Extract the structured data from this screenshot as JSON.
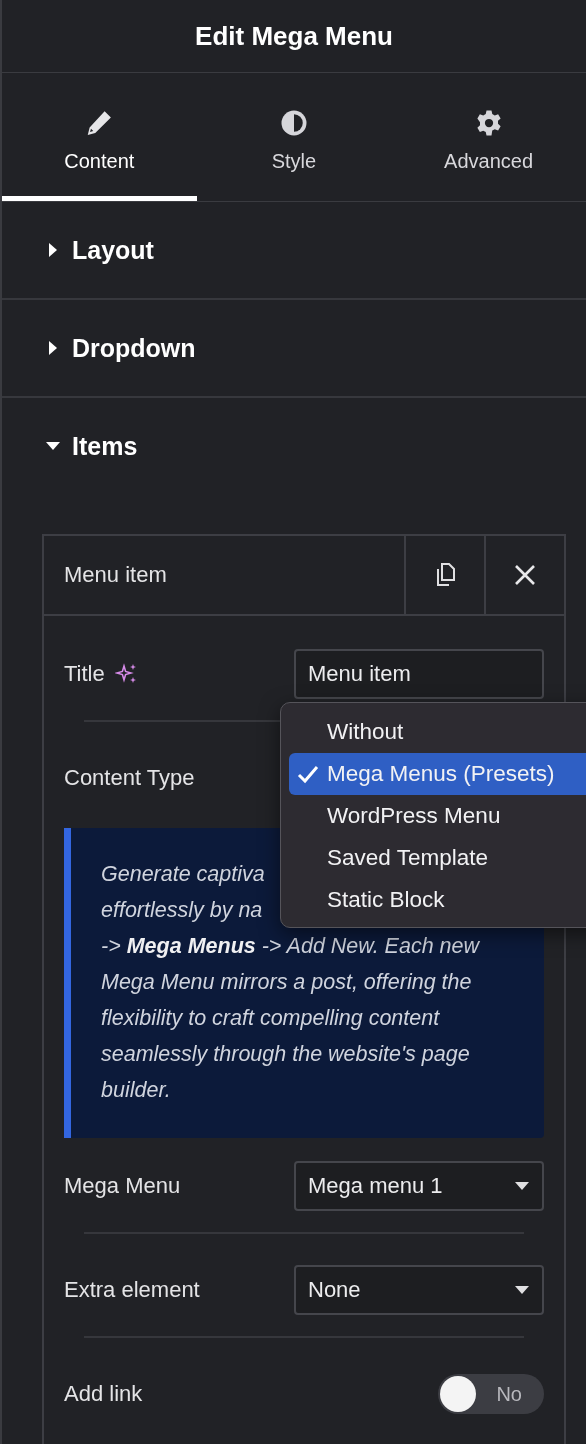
{
  "panel": {
    "title": "Edit Mega Menu"
  },
  "tabs": [
    {
      "label": "Content",
      "selected": true
    },
    {
      "label": "Style",
      "selected": false
    },
    {
      "label": "Advanced",
      "selected": false
    }
  ],
  "sections": [
    {
      "title": "Layout",
      "expanded": false
    },
    {
      "title": "Dropdown",
      "expanded": false
    },
    {
      "title": "Items",
      "expanded": true
    }
  ],
  "item": {
    "title": "Menu item",
    "fields": [
      {
        "kind": "text",
        "label": "Title",
        "value": "Menu item"
      },
      {
        "kind": "open_select",
        "label": "Content Type",
        "options": [
          {
            "label": "Without",
            "selected": false
          },
          {
            "label": "Mega Menus (Presets)",
            "selected": true
          },
          {
            "label": "WordPress Menu",
            "selected": false
          },
          {
            "label": "Saved Template",
            "selected": false
          },
          {
            "label": "Static Block",
            "selected": false
          }
        ]
      },
      {
        "kind": "note",
        "lines": [
          "Generate captiva",
          "effortlessly by na",
          "-> **Mega Menus** -> Add New. Each new",
          "Mega Menu mirrors a post, offering the",
          "flexibility to craft compelling content",
          "seamlessly through the website's page",
          "builder."
        ]
      },
      {
        "kind": "select",
        "label": "Mega Menu",
        "value": "Mega menu 1"
      },
      {
        "kind": "select",
        "label": "Extra element",
        "value": "None"
      },
      {
        "kind": "switch",
        "label": "Add link",
        "on": false,
        "state_label": "No"
      }
    ]
  }
}
